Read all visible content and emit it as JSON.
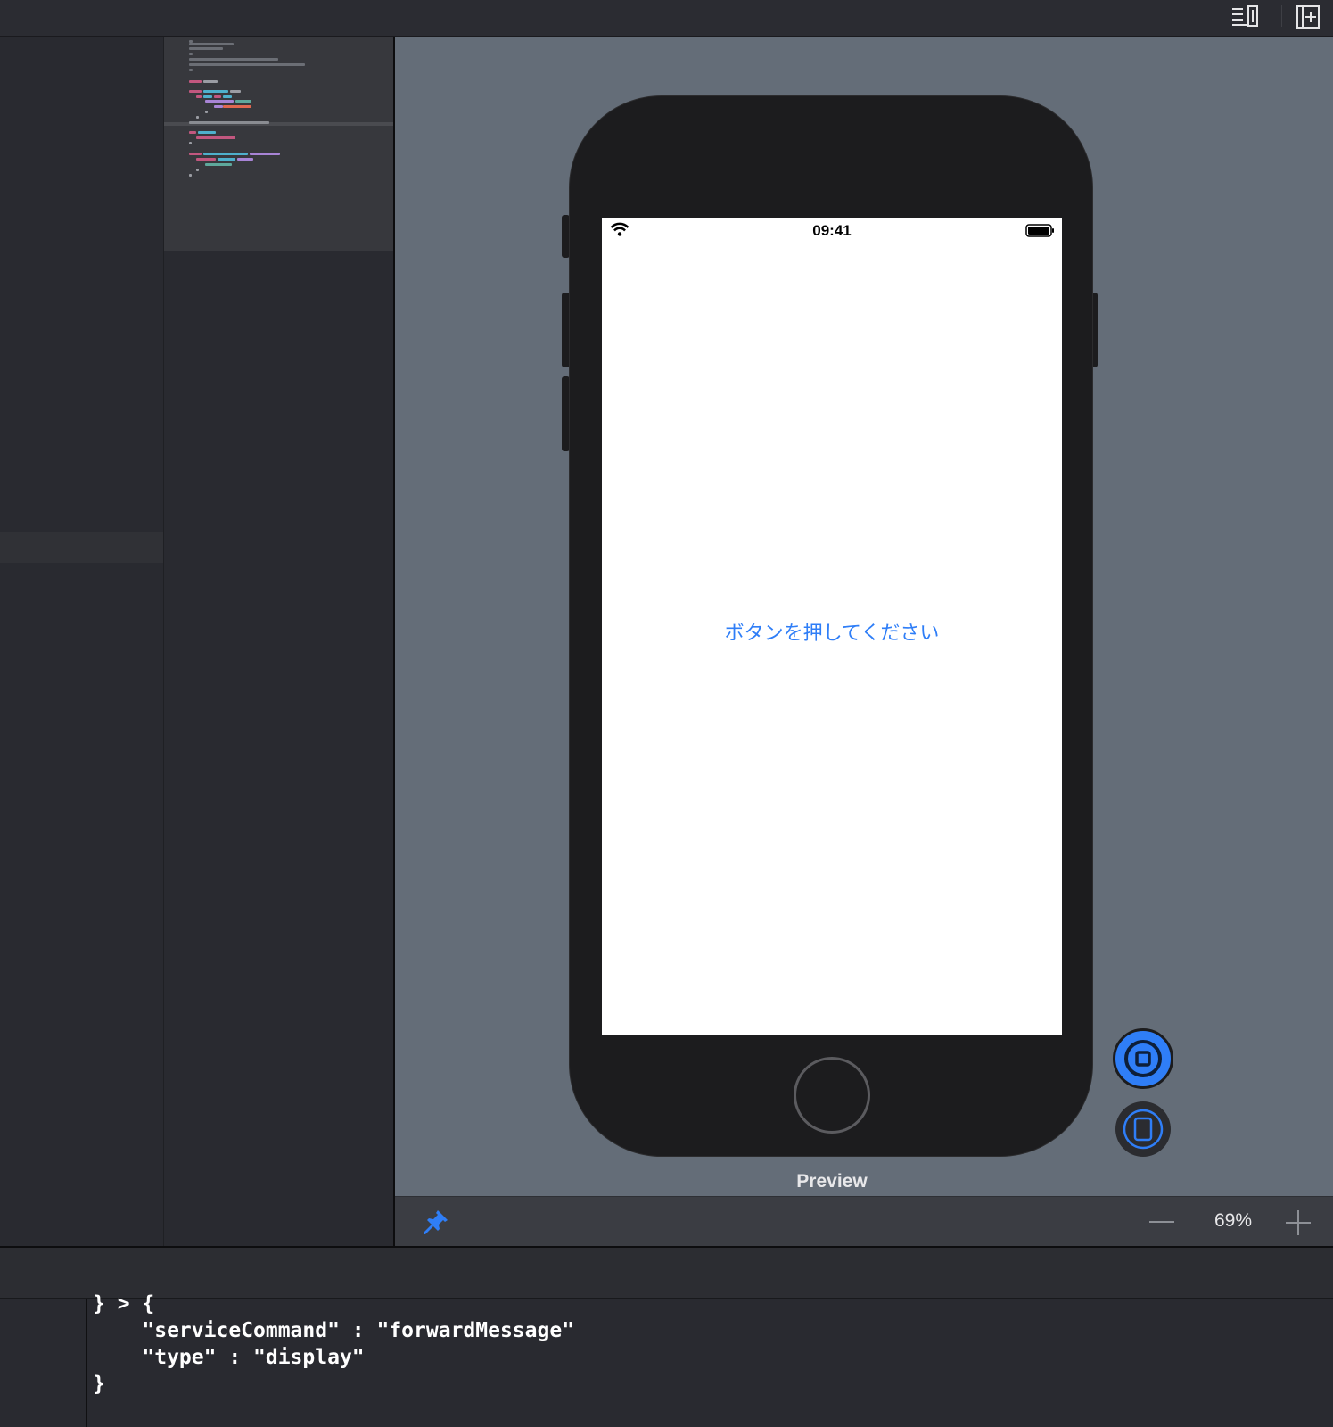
{
  "toolbar": {
    "icons": [
      "editor-options-icon",
      "add-library-icon"
    ]
  },
  "simulator": {
    "status_time": "09:41",
    "status_icons": [
      "wifi-icon",
      "battery-icon"
    ],
    "button_label": "ボタンを押してください"
  },
  "preview": {
    "label": "Preview",
    "buttons": [
      "live-preview-icon",
      "run-on-device-icon"
    ]
  },
  "bottom_toolbar": {
    "pin_icon": "pin-icon",
    "zoom_value": "69%",
    "zoom_out_icon": "minus-icon",
    "zoom_in_icon": "plus-icon"
  },
  "console": {
    "lines": [
      "} > {",
      "    \"serviceCommand\" : \"forwardMessage\"",
      "    \"type\" : \"display\"",
      "}"
    ]
  },
  "colors": {
    "accent": "#2f7ef7",
    "canvas_background": "#646d78",
    "device_body": "#1c1c1e"
  }
}
